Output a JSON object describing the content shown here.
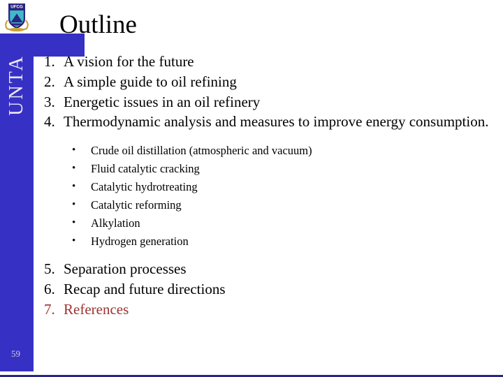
{
  "slide": {
    "title": "Outline",
    "page_number": "59",
    "vertical_text": "UNTA",
    "accent_color": "#9e3232",
    "brand_blue": "#3730c4",
    "rule_color": "#2b2780"
  },
  "logo": {
    "name": "ufcg-logo",
    "banner_text": "UFCG",
    "shield_field_color": "#3fb9c9",
    "shield_mountain_color": "#2b2480",
    "wreath_color": "#caa23a"
  },
  "outline": {
    "items": [
      {
        "num": "1.",
        "text": "A vision for the future",
        "accent": false
      },
      {
        "num": "2.",
        "text": "A simple guide to oil refining",
        "accent": false
      },
      {
        "num": "3.",
        "text": "Energetic issues in an oil refinery",
        "accent": false
      },
      {
        "num": "4.",
        "text": "Thermodynamic analysis and measures to improve energy consumption.",
        "accent": false
      }
    ],
    "sub_items": [
      {
        "bullet": "•",
        "text": "Crude oil distillation (atmospheric and vacuum)"
      },
      {
        "bullet": "•",
        "text": "Fluid catalytic cracking"
      },
      {
        "bullet": "•",
        "text": "Catalytic hydrotreating"
      },
      {
        "bullet": "•",
        "text": "Catalytic reforming"
      },
      {
        "bullet": "•",
        "text": "Alkylation"
      },
      {
        "bullet": "•",
        "text": "Hydrogen generation"
      }
    ],
    "items_tail": [
      {
        "num": "5.",
        "text": "Separation processes",
        "accent": false
      },
      {
        "num": "6.",
        "text": "Recap and future directions",
        "accent": false
      },
      {
        "num": "7.",
        "text": "References",
        "accent": true
      }
    ]
  }
}
